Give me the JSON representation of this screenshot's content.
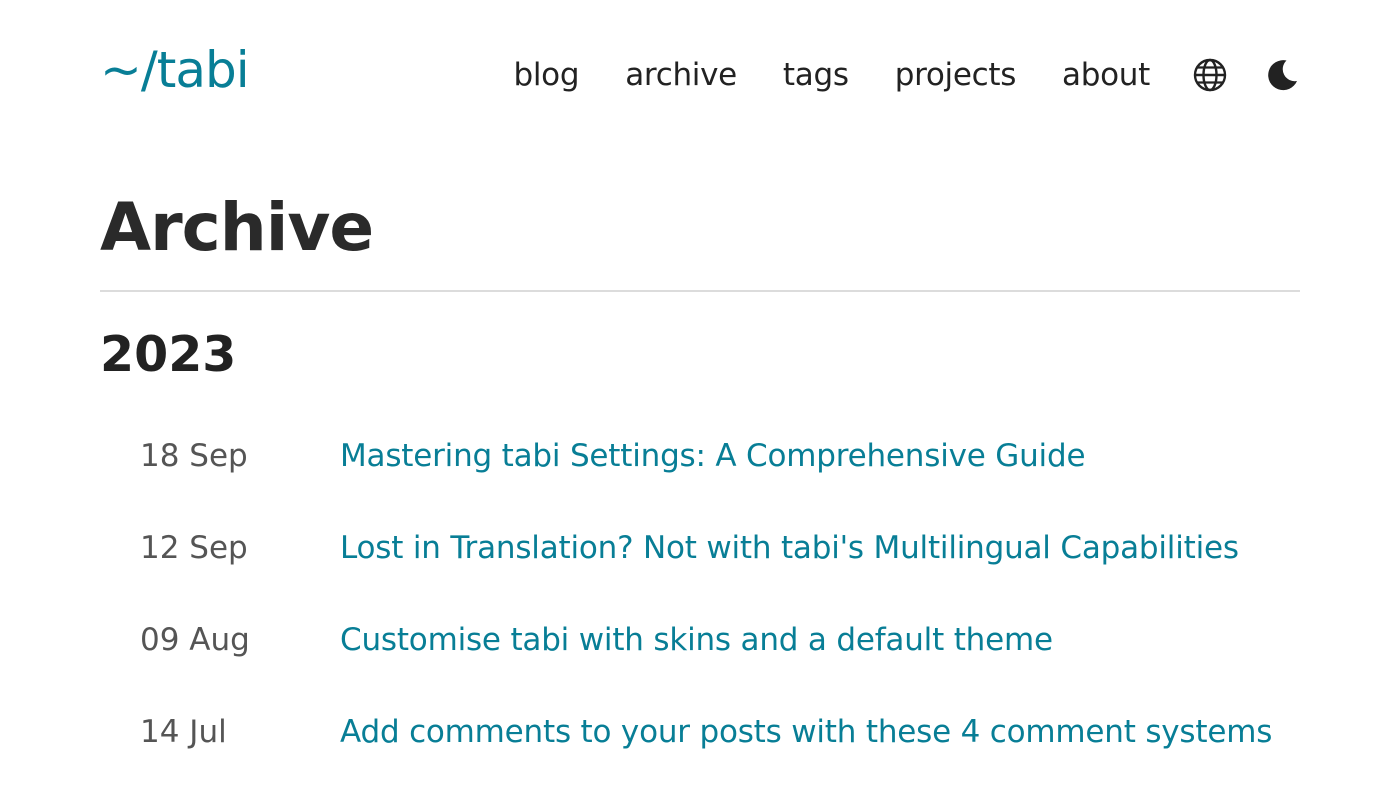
{
  "site": {
    "logo": "~/tabi",
    "accent_color": "#087e96"
  },
  "nav": {
    "links": [
      "blog",
      "archive",
      "tags",
      "projects",
      "about"
    ],
    "language_icon": "globe-icon",
    "theme_icon": "moon-icon"
  },
  "page": {
    "title": "Archive"
  },
  "archive": {
    "year": "2023",
    "posts": [
      {
        "date": "18 Sep",
        "title": "Mastering tabi Settings: A Comprehensive Guide"
      },
      {
        "date": "12 Sep",
        "title": "Lost in Translation? Not with tabi's Multilingual Capabilities"
      },
      {
        "date": "09 Aug",
        "title": "Customise tabi with skins and a default theme"
      },
      {
        "date": "14 Jul",
        "title": "Add comments to your posts with these 4 comment systems"
      }
    ]
  }
}
